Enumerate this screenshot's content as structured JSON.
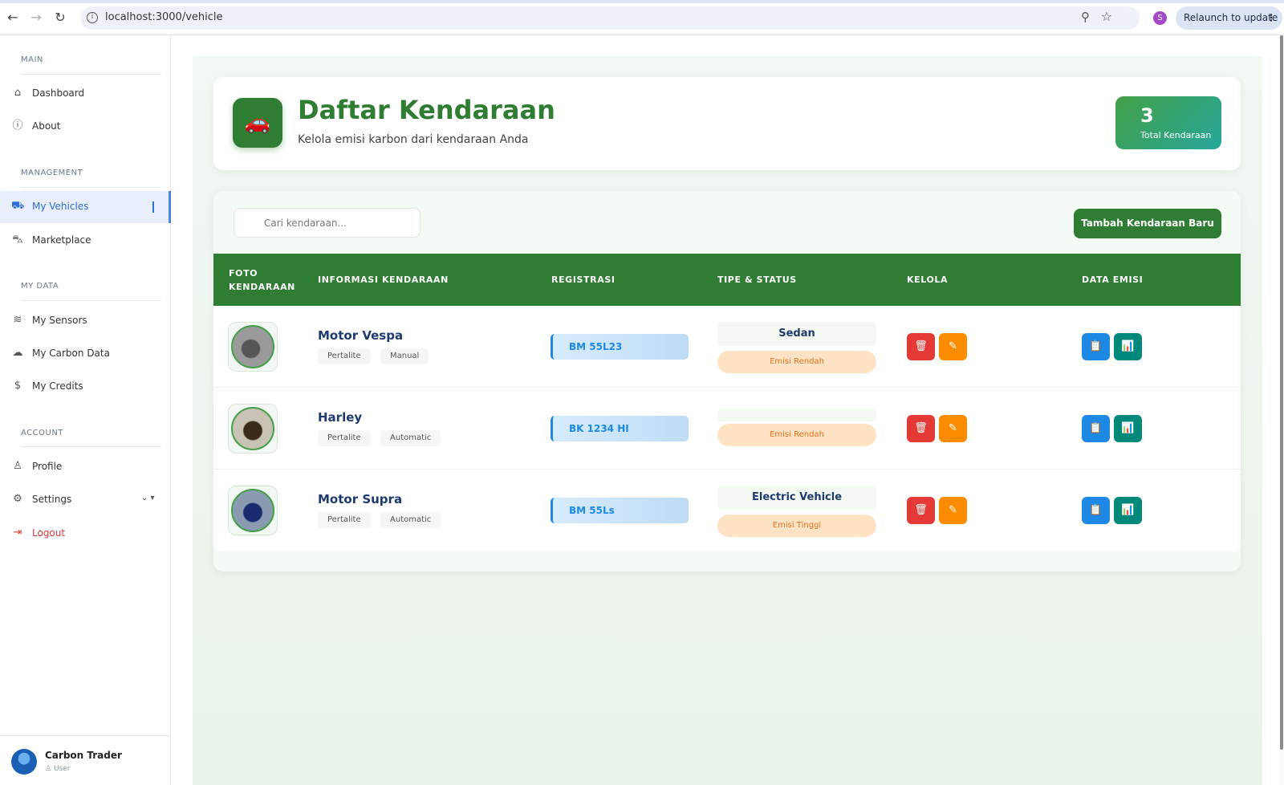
{
  "browser": {
    "url": "localhost:3000/vehicle",
    "profile_initial": "S",
    "relaunch_label": "Relaunch to update"
  },
  "sidebar": {
    "sections": [
      {
        "title": "MAIN"
      },
      {
        "title": "MANAGEMENT"
      },
      {
        "title": "MY DATA"
      },
      {
        "title": "ACCOUNT"
      }
    ],
    "items": [
      {
        "label": "Dashboard",
        "icon": "home-icon"
      },
      {
        "label": "About",
        "icon": "info-icon"
      },
      {
        "label": "My Vehicles",
        "icon": "car-icon",
        "active": true
      },
      {
        "label": "Marketplace",
        "icon": "cart-icon"
      },
      {
        "label": "My Sensors",
        "icon": "wifi-icon"
      },
      {
        "label": "My Carbon Data",
        "icon": "cloud-icon"
      },
      {
        "label": "My Credits",
        "icon": "dollar-icon"
      },
      {
        "label": "Profile",
        "icon": "user-icon"
      },
      {
        "label": "Settings",
        "icon": "gear-icon"
      },
      {
        "label": "Logout",
        "icon": "logout-icon"
      }
    ],
    "user": {
      "name": "Carbon Trader",
      "role": "User"
    }
  },
  "header": {
    "title": "Daftar Kendaraan",
    "subtitle": "Kelola emisi karbon dari kendaraan Anda",
    "stat_value": "3",
    "stat_label": "Total Kendaraan"
  },
  "toolbar": {
    "search_placeholder": "Cari kendaraan...",
    "add_label": "Tambah Kendaraan Baru"
  },
  "table": {
    "columns": [
      "FOTO KENDARAAN",
      "INFORMASI KENDARAAN",
      "REGISTRASI",
      "TIPE & STATUS",
      "KELOLA",
      "DATA EMISI"
    ],
    "rows": [
      {
        "name": "Motor Vespa",
        "fuel": "Pertalite",
        "transmission": "Manual",
        "registration": "BM 55L23",
        "type": "Sedan",
        "emission": "Emisi Rendah"
      },
      {
        "name": "Harley",
        "fuel": "Pertalite",
        "transmission": "Automatic",
        "registration": "BK 1234 HI",
        "type": "",
        "emission": "Emisi Rendah"
      },
      {
        "name": "Motor Supra",
        "fuel": "Pertalite",
        "transmission": "Automatic",
        "registration": "BM 55Ls",
        "type": "Electric Vehicle",
        "emission": "Emisi Tinggi"
      }
    ]
  },
  "colors": {
    "primary_green": "#2e7d32",
    "accent_blue": "#1e88e5",
    "danger_red": "#e53935",
    "warning_orange": "#fb8c00",
    "teal": "#00897b"
  }
}
